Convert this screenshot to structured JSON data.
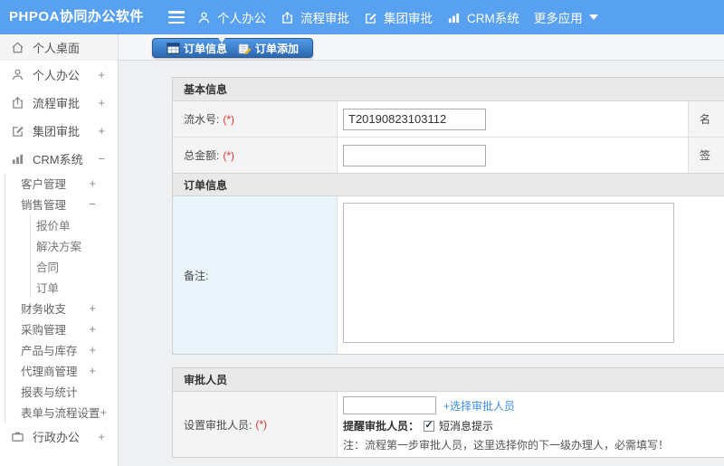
{
  "navbar": {
    "logo": "PHPOA协同办公软件",
    "items": [
      {
        "label": "个人办公",
        "icon": "user-icon"
      },
      {
        "label": "流程审批",
        "icon": "approval-icon"
      },
      {
        "label": "集团审批",
        "icon": "edit-icon"
      },
      {
        "label": "CRM系统",
        "icon": "chart-icon"
      },
      {
        "label": "更多应用",
        "icon": "caret-down-icon"
      }
    ]
  },
  "sidebar": {
    "items": [
      {
        "label": "个人桌面",
        "icon": "home-icon",
        "toggle": ""
      },
      {
        "label": "个人办公",
        "icon": "user-icon",
        "toggle": "+"
      },
      {
        "label": "流程审批",
        "icon": "approval-icon",
        "toggle": "+"
      },
      {
        "label": "集团审批",
        "icon": "edit-icon",
        "toggle": "+"
      },
      {
        "label": "CRM系统",
        "icon": "chart-icon",
        "toggle": "−"
      },
      {
        "label": "行政办公",
        "icon": "briefcase-icon",
        "toggle": "+"
      }
    ],
    "crm_children": [
      {
        "label": "客户管理",
        "toggle": "+"
      },
      {
        "label": "销售管理",
        "toggle": "−"
      },
      {
        "label": "财务收支",
        "toggle": "+"
      },
      {
        "label": "采购管理",
        "toggle": "+"
      },
      {
        "label": "产品与库存",
        "toggle": "+"
      },
      {
        "label": "代理商管理",
        "toggle": "+"
      },
      {
        "label": "报表与统计",
        "toggle": ""
      },
      {
        "label": "表单与流程设置",
        "toggle": "+"
      }
    ],
    "sales_children": [
      {
        "label": "报价单"
      },
      {
        "label": "解决方案"
      },
      {
        "label": "合同"
      },
      {
        "label": "订单"
      }
    ]
  },
  "tabs": [
    {
      "label": "订单信息",
      "icon": "table-icon"
    },
    {
      "label": "订单添加",
      "icon": "note-add-icon"
    }
  ],
  "form": {
    "sections": {
      "basic": "基本信息",
      "order": "订单信息",
      "approver": "审批人员"
    },
    "fields": {
      "serial": {
        "label": "流水号:",
        "required": "(*)",
        "value": "T20190823103112"
      },
      "amount": {
        "label": "总金额:",
        "required": "(*)",
        "value": ""
      },
      "remark": {
        "label": "备注:",
        "value": ""
      },
      "approver": {
        "label": "设置审批人员:",
        "required": "(*)",
        "value": "",
        "link_label": "+选择审批人员"
      },
      "remind": {
        "label": "提醒审批人员：",
        "checkbox_label": "短消息提示",
        "checked": true
      },
      "note": "注：流程第一步审批人员，这里选择你的下一级办理人，必需填写！"
    },
    "second_column": {
      "row1_label": "名",
      "row2_label": "签"
    }
  },
  "colors": {
    "navbar_bg": "#58a0f0",
    "tab_gradient_top": "#529ae8",
    "tab_gradient_bottom": "#2c66ae",
    "link": "#3b8fe8",
    "required": "#e03131",
    "remark_label_bg": "#e9f4fb",
    "section_header_bg": "#e9e9e9"
  }
}
